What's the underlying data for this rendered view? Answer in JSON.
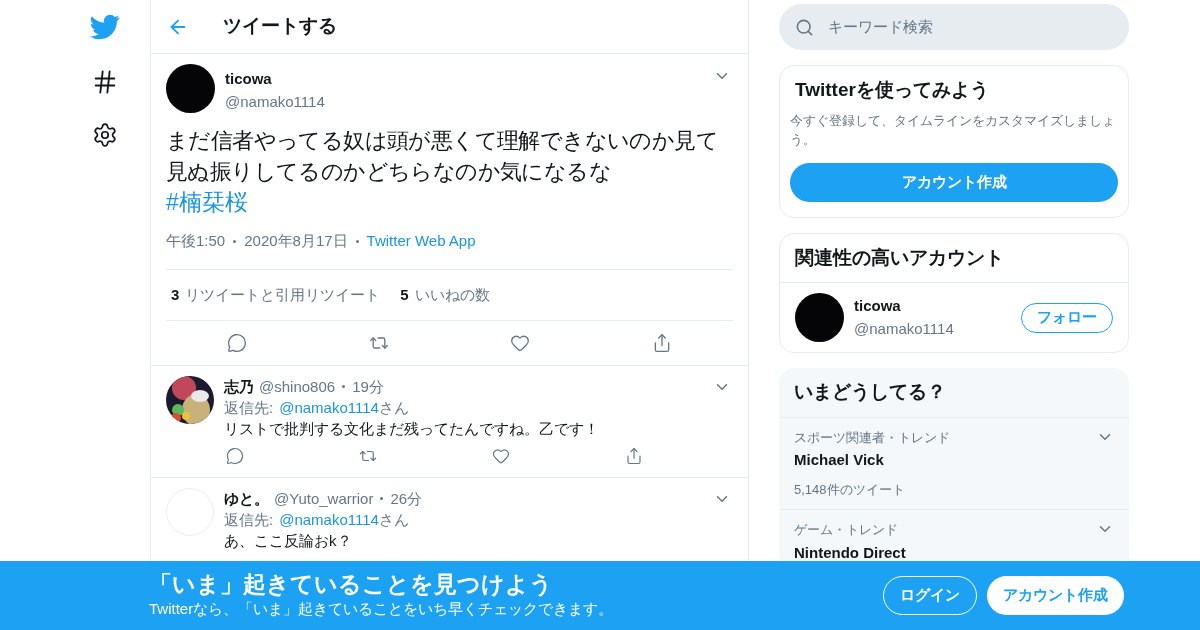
{
  "header": {
    "title": "ツイートする"
  },
  "tweet": {
    "name": "ticowa",
    "handle": "@namako1114",
    "text": "まだ信者やってる奴は頭が悪くて理解できないのか見て見ぬ振りしてるのかどちらなのか気になるな",
    "hashtag": "#楠栞桜",
    "time": "午後1:50",
    "date": "2020年8月17日",
    "source": "Twitter Web App",
    "retweets": "3",
    "retweets_label": "リツイートと引用リツイート",
    "likes": "5",
    "likes_label": "いいねの数"
  },
  "replies": [
    {
      "kind": "picture",
      "name": "志乃",
      "handle": "@shino806",
      "ago": "19分",
      "reply_prefix": "返信先:",
      "reply_to": "@namako1114",
      "reply_suffix": "さん",
      "text": "リストで批判する文化まだ残ってたんですね。乙です！",
      "actions": true
    },
    {
      "kind": "plain",
      "name": "ゆと。",
      "handle": "@Yuto_warrior",
      "ago": "26分",
      "reply_prefix": "返信先:",
      "reply_to": "@namako1114",
      "reply_suffix": "さん",
      "text": "あ、ここ反論おk？",
      "actions": false
    }
  ],
  "search": {
    "placeholder": "キーワード検索"
  },
  "signup_card": {
    "title": "Twitterを使ってみよう",
    "text": "今すぐ登録して、タイムラインをカスタマイズしましょう。",
    "button": "アカウント作成"
  },
  "related": {
    "title": "関連性の高いアカウント",
    "accounts": [
      {
        "name": "ticowa",
        "handle": "@namako1114",
        "button": "フォロー"
      }
    ]
  },
  "trends": {
    "title": "いまどうしてる？",
    "items": [
      {
        "context": "スポーツ関連者・トレンド",
        "name": "Michael Vick",
        "count": "5,148件のツイート"
      },
      {
        "context": "ゲーム・トレンド",
        "name": "Nintendo Direct"
      }
    ]
  },
  "bottom_bar": {
    "title": "「いま」起きていることを見つけよう",
    "subtitle": "Twitterなら、「いま」起きていることをいち早くチェックできます。",
    "login": "ログイン",
    "signup": "アカウント作成"
  }
}
